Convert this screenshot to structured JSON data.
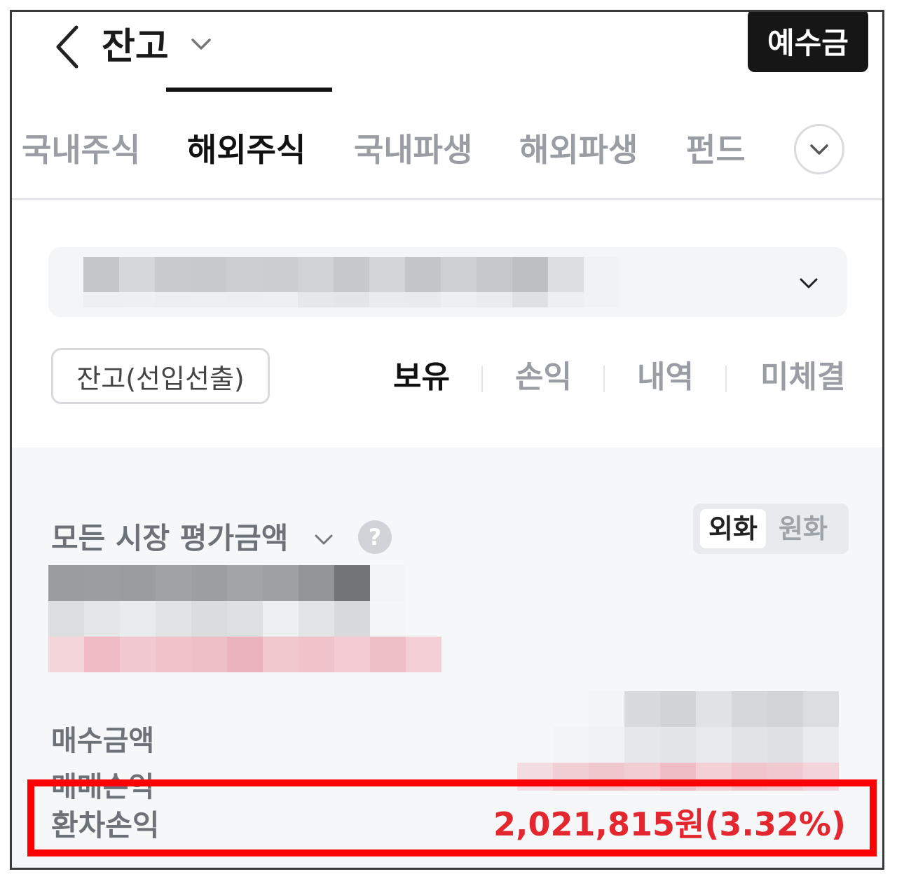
{
  "header": {
    "title": "잔고",
    "deposit_label": "예수금"
  },
  "tabs": [
    {
      "label": "국내주식",
      "active": false
    },
    {
      "label": "해외주식",
      "active": true
    },
    {
      "label": "국내파생",
      "active": false
    },
    {
      "label": "해외파생",
      "active": false
    },
    {
      "label": "펀드",
      "active": false
    }
  ],
  "filters": {
    "balance_button": "잔고(선입선출)",
    "segments": [
      {
        "label": "보유",
        "active": true
      },
      {
        "label": "손익",
        "active": false
      },
      {
        "label": "내역",
        "active": false
      },
      {
        "label": "미체결",
        "active": false
      }
    ]
  },
  "summary": {
    "market_label": "모든 시장 평가금액",
    "help_label": "?",
    "currency_options": [
      {
        "label": "외화",
        "active": true
      },
      {
        "label": "원화",
        "active": false
      }
    ],
    "rows": [
      {
        "label": "매수금액"
      },
      {
        "label": "매매손익"
      }
    ],
    "fx_gain": {
      "label": "환차손익",
      "value": "2,021,815원(3.32%)"
    }
  },
  "colors": {
    "accent_red": "#e4262f",
    "highlight_box": "#ff0000",
    "deposit_button_bg": "#161616"
  },
  "icons": {
    "back": "chevron-left-icon",
    "title_dropdown": "chevron-down-icon",
    "tab_more": "chevron-down-icon",
    "account_dropdown": "chevron-down-icon",
    "market_dropdown": "chevron-down-icon",
    "help": "question-icon"
  }
}
